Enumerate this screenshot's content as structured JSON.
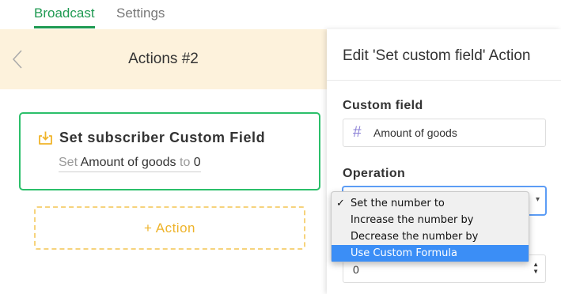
{
  "tabs": [
    {
      "label": "Broadcast",
      "active": true
    },
    {
      "label": "Settings",
      "active": false
    }
  ],
  "header": {
    "title": "Actions #2"
  },
  "card": {
    "title": "Set subscriber Custom Field",
    "desc_prefix": "Set",
    "desc_field": "Amount of goods",
    "desc_mid": "to",
    "desc_value": "0"
  },
  "add_action": {
    "label": "+ Action"
  },
  "panel": {
    "title": "Edit 'Set custom field' Action",
    "custom_field_label": "Custom field",
    "custom_field_value": "Amount of goods",
    "operation_label": "Operation",
    "number_value": "0"
  },
  "dropdown": {
    "options": [
      {
        "label": "Set the number to",
        "checked": true
      },
      {
        "label": "Increase the number by",
        "checked": false
      },
      {
        "label": "Decrease the number by",
        "checked": false
      },
      {
        "label": "Use Custom Formula",
        "highlighted": true
      }
    ],
    "check_glyph": "✓"
  },
  "colors": {
    "accent_green": "#1f9a52",
    "card_border": "#2bbf6a",
    "header_bg": "#fdf2dc",
    "action_yellow": "#eeb32a",
    "highlight_blue": "#3b8ef6"
  },
  "icons": {
    "back": "chevron-left-icon",
    "card": "download-box-icon",
    "hash": "hash-icon"
  }
}
